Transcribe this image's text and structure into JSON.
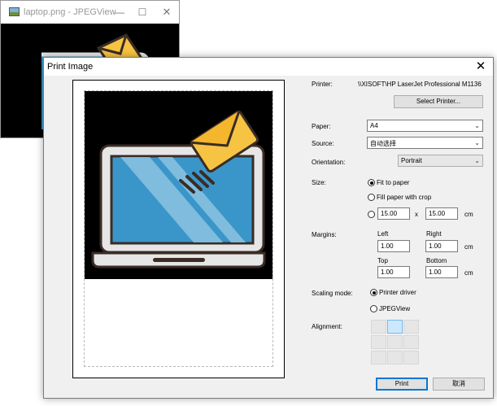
{
  "background_window": {
    "title": "laptop.png - JPEGView",
    "controls": {
      "minimize": "—",
      "maximize": "☐",
      "close": "✕"
    }
  },
  "dialog": {
    "title": "Print Image",
    "close_glyph": "✕",
    "printer_label": "Printer:",
    "printer_value": "\\\\XISOFT\\HP LaserJet Professional M1136",
    "select_printer_button": "Select Printer...",
    "paper_label": "Paper:",
    "paper_value": "A4",
    "source_label": "Source:",
    "source_value": "自动选择",
    "orientation_label": "Orientation:",
    "orientation_value": "Portrait",
    "size_label": "Size:",
    "size_options": {
      "fit": "Fit to paper",
      "fill": "Fill paper with crop"
    },
    "size_selected": "fit",
    "size_width": "15.00",
    "size_x": "x",
    "size_height": "15.00",
    "size_unit": "cm",
    "margins_label": "Margins:",
    "margins": {
      "left_label": "Left",
      "left": "1.00",
      "right_label": "Right",
      "right": "1.00",
      "top_label": "Top",
      "top": "1.00",
      "bottom_label": "Bottom",
      "bottom": "1.00",
      "unit": "cm"
    },
    "scaling_label": "Scaling mode:",
    "scaling_options": {
      "printer": "Printer driver",
      "jpegview": "JPEGView"
    },
    "scaling_selected": "printer",
    "alignment_label": "Alignment:",
    "alignment_selected": "top-center",
    "print_button": "Print",
    "cancel_button": "取消",
    "chevron": "⌄"
  },
  "colors": {
    "accent": "#0078d7",
    "envelope": "#f6c343",
    "screen_blue": "#3a96c9",
    "alignment_selected": "#cce8ff"
  }
}
